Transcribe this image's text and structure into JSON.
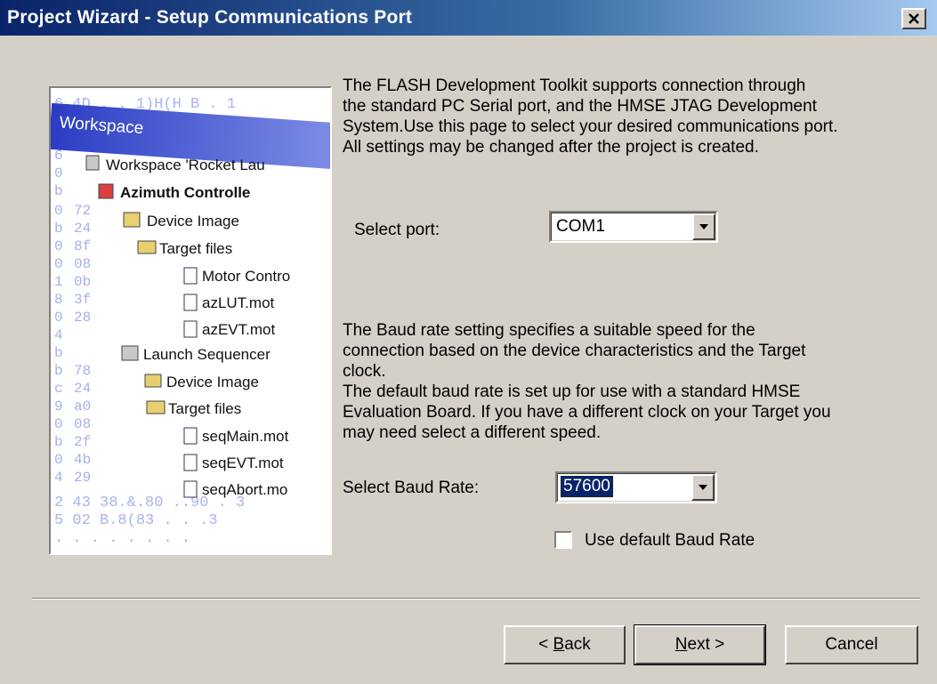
{
  "window": {
    "title": "Project Wizard - Setup Communications Port",
    "close_icon": "close-icon"
  },
  "illustration": {
    "workspace_title": "Workspace",
    "root": "Workspace 'Rocket Lau",
    "project1": "Azimuth Controlle",
    "device_image": "Device Image",
    "target_files": "Target files",
    "file1": "Motor Contro",
    "file2": "azLUT.mot",
    "file3": "azEVT.mot",
    "project2": "Launch Sequencer",
    "device_image2": "Device Image",
    "target_files2": "Target files",
    "file4": "seqMain.mot",
    "file5": "seqEVT.mot",
    "file6": "seqAbort.mo"
  },
  "intro_text": "The FLASH Development Toolkit supports connection through\nthe standard PC Serial port, and the HMSE JTAG Development\nSystem.Use this page to select your desired communications port.\nAll settings may be changed after the project is created.",
  "port": {
    "label": "Select port:",
    "value": "COM1"
  },
  "baud_text": "The Baud rate setting specifies a suitable speed for the\nconnection based on the device characteristics and the Target\nclock.\nThe default baud rate is set up for use with a standard HMSE\nEvaluation Board. If you have a different clock on your Target you\nmay need select a different speed.",
  "baud": {
    "label": "Select Baud Rate:",
    "value": "57600"
  },
  "default_baud": {
    "label": "Use default Baud Rate",
    "checked": false
  },
  "buttons": {
    "back_prefix": "< ",
    "back_key": "B",
    "back_rest": "ack",
    "next_key": "N",
    "next_rest": "ext >",
    "cancel": "Cancel"
  },
  "colors": {
    "title_start": "#0a246a",
    "title_end": "#a6caf0",
    "face": "#d4d0c8",
    "selection": "#0a246a"
  }
}
